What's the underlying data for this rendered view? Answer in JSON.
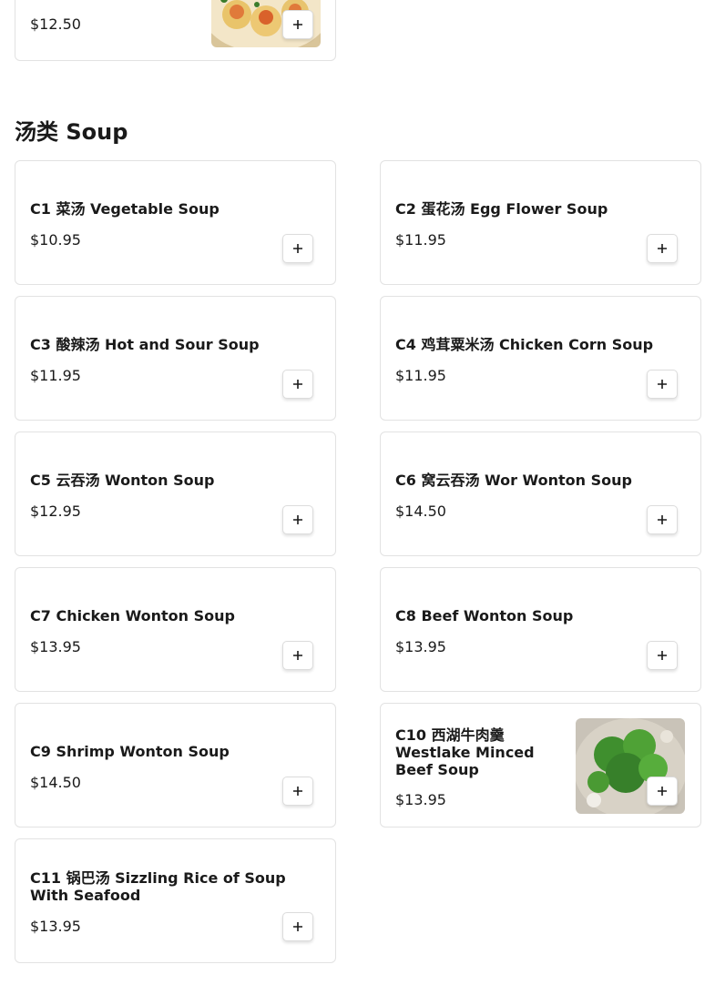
{
  "prev_item": {
    "price": "$12.50",
    "image_icon": "dumpling-photo"
  },
  "section": {
    "title": "汤类 Soup"
  },
  "items": [
    {
      "name": "C1 菜汤 Vegetable Soup",
      "price": "$10.95"
    },
    {
      "name": "C2 蛋花汤 Egg Flower Soup",
      "price": "$11.95"
    },
    {
      "name": "C3 酸辣汤 Hot and Sour Soup",
      "price": "$11.95"
    },
    {
      "name": "C4 鸡茸粟米汤 Chicken Corn Soup",
      "price": "$11.95"
    },
    {
      "name": "C5 云吞汤 Wonton Soup",
      "price": "$12.95"
    },
    {
      "name": "C6 窝云吞汤 Wor Wonton Soup",
      "price": "$14.50"
    },
    {
      "name": "C7 Chicken Wonton Soup",
      "price": "$13.95"
    },
    {
      "name": "C8 Beef Wonton Soup",
      "price": "$13.95"
    },
    {
      "name": "C9 Shrimp Wonton Soup",
      "price": "$14.50"
    },
    {
      "name": "C10 西湖牛肉羹 Westlake Minced Beef Soup",
      "price": "$13.95",
      "image_icon": "beef-soup-photo"
    },
    {
      "name": "C11 锅巴汤 Sizzling Rice of Soup With Seafood",
      "price": "$13.95"
    }
  ],
  "add_icon": "plus-icon"
}
